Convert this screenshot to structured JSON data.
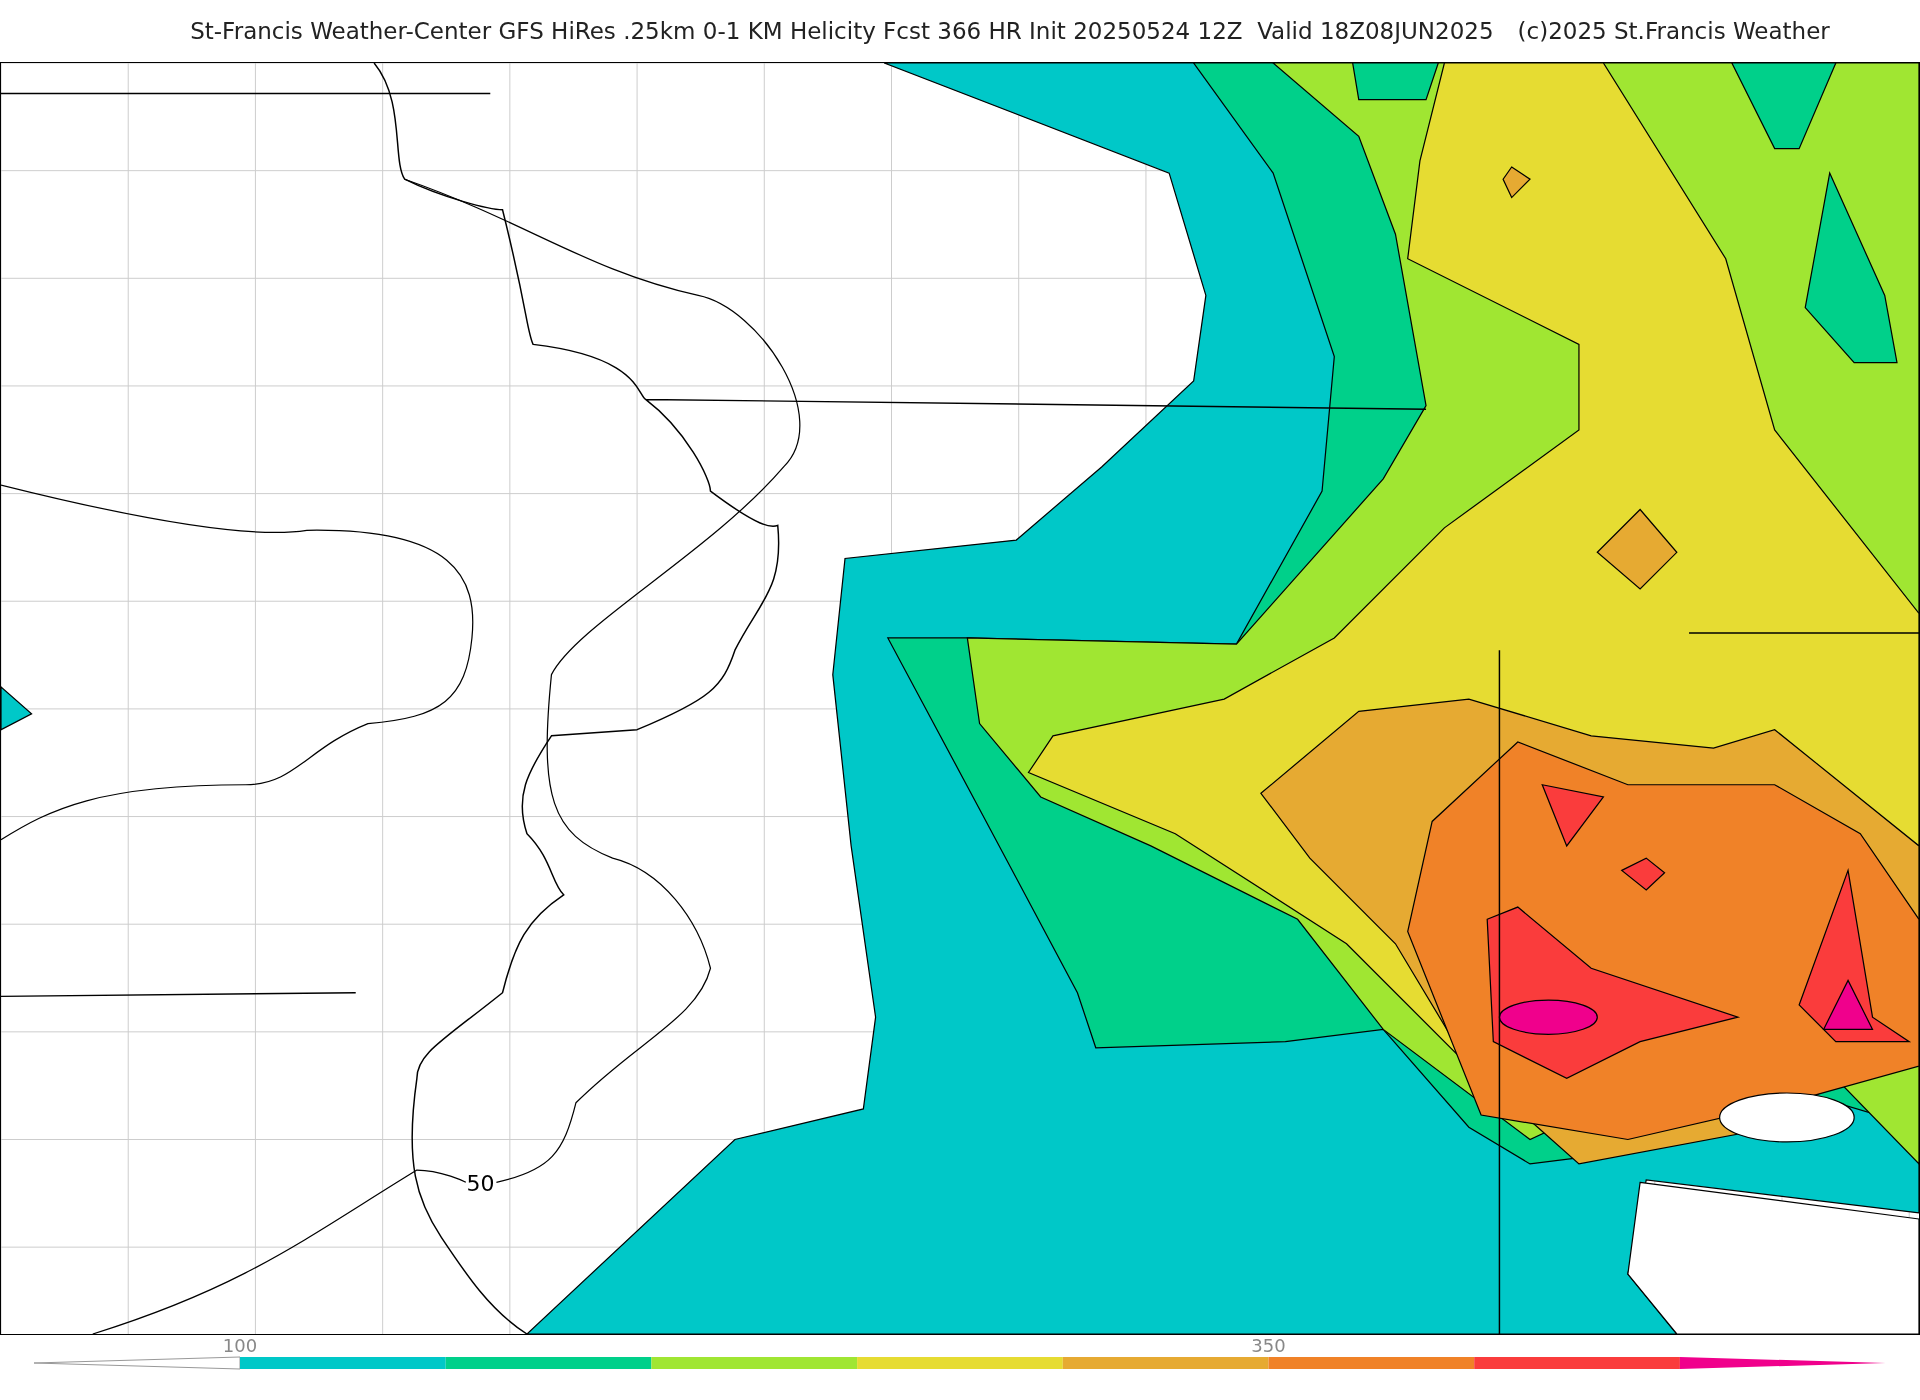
{
  "title": "St-Francis Weather-Center GFS HiRes .25km 0-1 KM Helicity Fcst 366 HR Init 20250524 12Z  Valid 18Z08JUN2025",
  "copyright": "(c)2025 St.Francis Weather",
  "map": {
    "contour_label": "50"
  },
  "colorbar": {
    "bins": [
      {
        "color": "#00c8c8",
        "tick_label": "100"
      },
      {
        "color": "#00d08a"
      },
      {
        "color": "#a0e632"
      },
      {
        "color": "#e6dc32"
      },
      {
        "color": "#e6aa32"
      },
      {
        "color": "#f08228",
        "tick_label": "350"
      },
      {
        "color": "#fa3c3c"
      },
      {
        "color": "#f0008c"
      }
    ]
  }
}
